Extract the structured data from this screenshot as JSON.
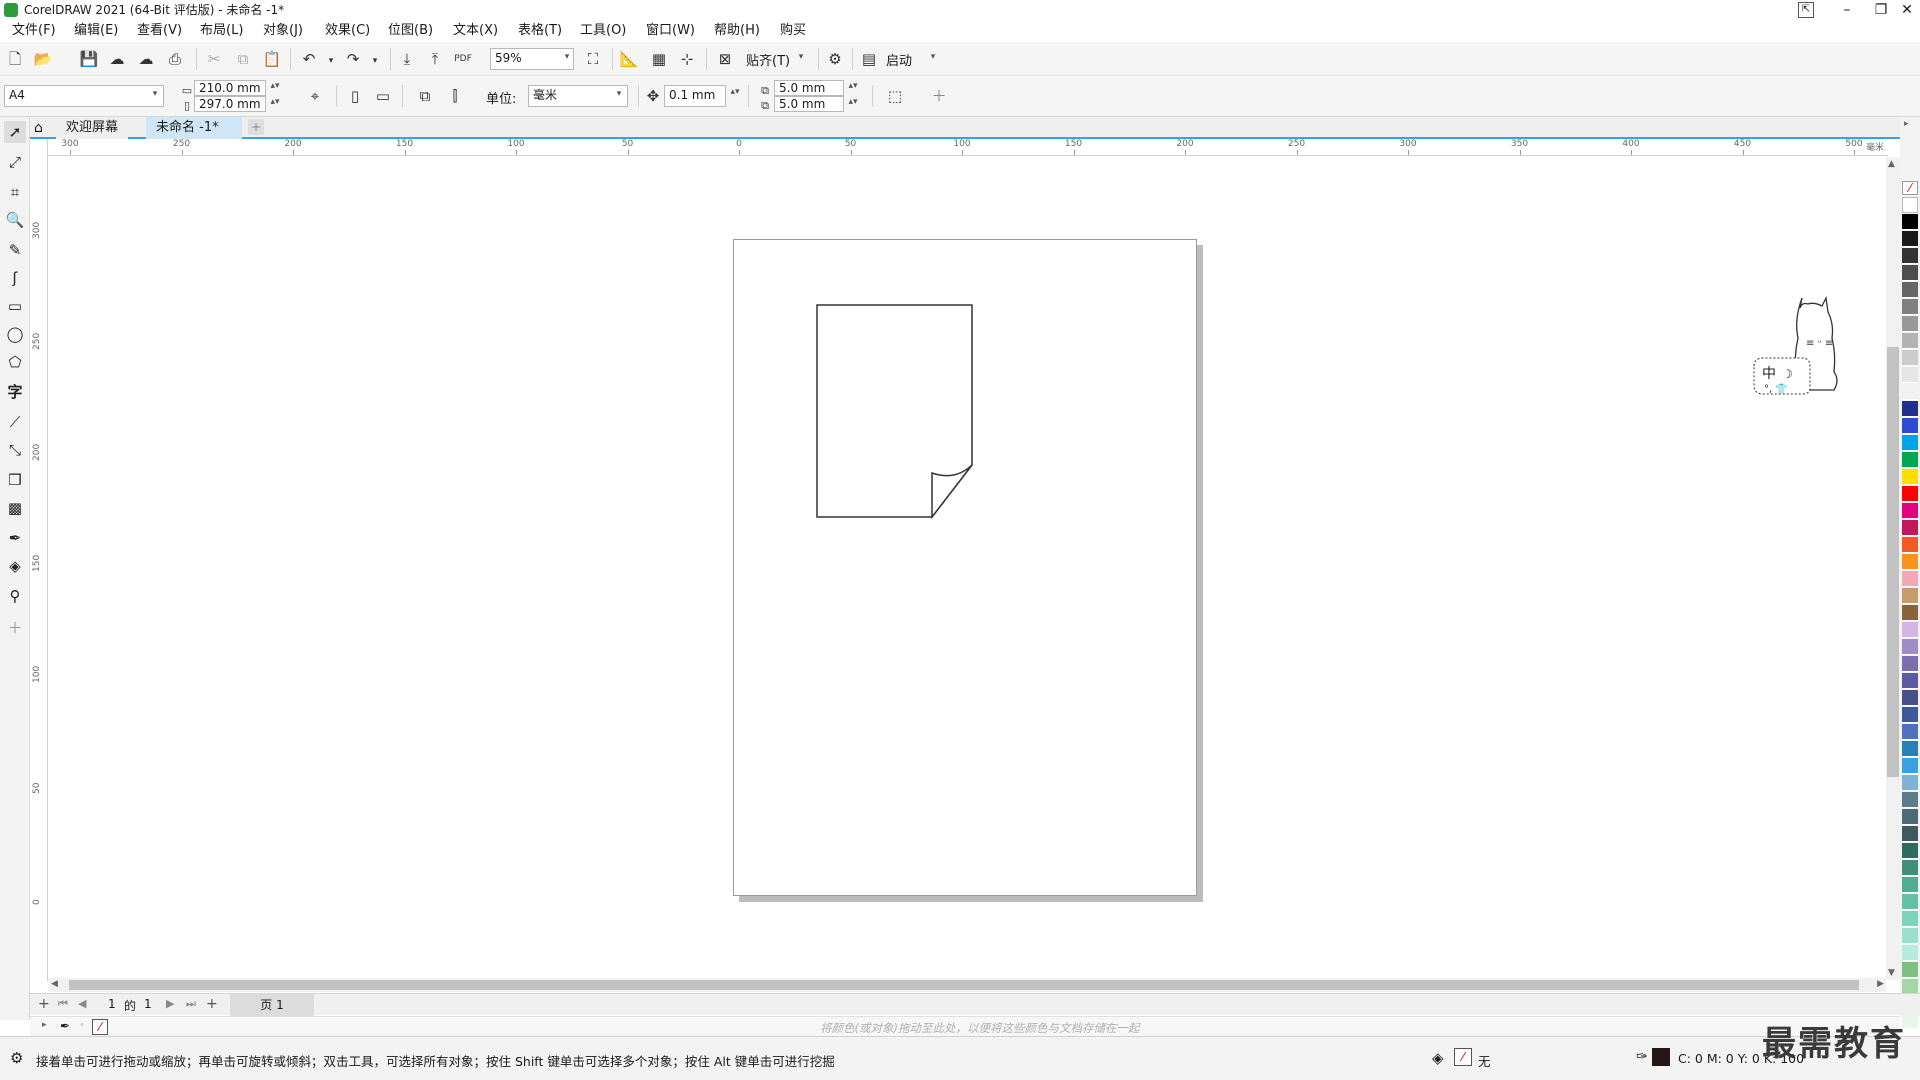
{
  "window": {
    "title": "CorelDRAW 2021 (64-Bit 评估版) - 未命名 -1*",
    "minimize": "–",
    "maximize": "❐",
    "close": "✕"
  },
  "menu": [
    "文件(F)",
    "编辑(E)",
    "查看(V)",
    "布局(L)",
    "对象(J)",
    "效果(C)",
    "位图(B)",
    "文本(X)",
    "表格(T)",
    "工具(O)",
    "窗口(W)",
    "帮助(H)",
    "购买"
  ],
  "toolbar": {
    "zoom": "59%",
    "snap_label": "贴齐(T)",
    "launch_label": "启动"
  },
  "property_bar": {
    "page_size": "A4",
    "width": "210.0 mm",
    "height": "297.0 mm",
    "units_label": "单位:",
    "units_value": "毫米",
    "nudge": "0.1 mm",
    "dup_x": "5.0 mm",
    "dup_y": "5.0 mm"
  },
  "tabs": [
    {
      "label": "欢迎屏幕"
    },
    {
      "label": "未命名 -1*"
    }
  ],
  "ruler": {
    "h_ticks": [
      "300",
      "250",
      "200",
      "150",
      "100",
      "50",
      "0",
      "50",
      "100",
      "150",
      "200",
      "250",
      "300",
      "350",
      "400",
      "450",
      "500"
    ],
    "h_unit": "毫米",
    "v_ticks": [
      "300",
      "250",
      "200",
      "150",
      "100",
      "50",
      "0"
    ]
  },
  "page_nav": {
    "current": "1",
    "of_label": "的",
    "total": "1",
    "page_tab": "页 1"
  },
  "color_doc_hint": "将颜色(或对象)拖动至此处，以便将这些颜色与文档存储在一起",
  "status": {
    "message": "接着单击可进行拖动或缩放；再单击可旋转或倾斜；双击工具，可选择所有对象；按住 Shift 键单击可选择多个对象；按住 Alt 键单击可进行挖掘",
    "fill_label": "无",
    "outline_values": "C: 0 M: 0 Y: 0 K: 100"
  },
  "mascot": {
    "label": "中"
  },
  "watermark": "最需教育",
  "palette": [
    "#ffffff",
    "#000000",
    "#1a1a1a",
    "#333333",
    "#4d4d4d",
    "#666666",
    "#808080",
    "#999999",
    "#b3b3b3",
    "#cccccc",
    "#e6e6e6",
    "#f2f2f2",
    "#1e2f8f",
    "#2b4bd1",
    "#00a2e8",
    "#00a651",
    "#ffde00",
    "#ff0000",
    "#e4007f",
    "#c2185b",
    "#f15a24",
    "#f7941d",
    "#f4a7b9",
    "#c69c6d",
    "#8c6239",
    "#d4b5e3",
    "#9e8cc6",
    "#7b6fb0",
    "#5c5aa0",
    "#4a4f8c",
    "#3c5a99",
    "#4f6fbf",
    "#2980b9",
    "#3aa0e0",
    "#7fb3d5",
    "#5d7c8a",
    "#4e6b73",
    "#3e5a5e",
    "#2f6b5e",
    "#3f8f7a",
    "#4fae8f",
    "#62c2a8",
    "#7ed3bd",
    "#9be0cc",
    "#b7ecdc",
    "#7fbf7f",
    "#a5d6a7",
    "#c8e6c9",
    "#e8f5e9"
  ],
  "colors": {
    "accent": "#3aa0e0",
    "outline_swatch": "#231815"
  }
}
